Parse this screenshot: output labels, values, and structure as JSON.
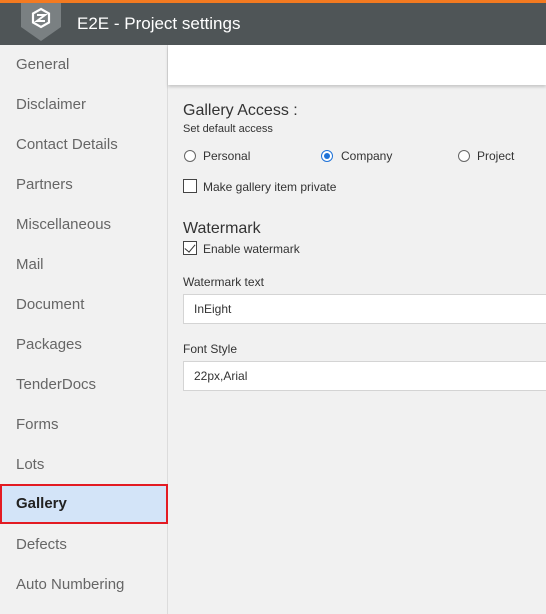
{
  "app": {
    "title": "E2E - Project settings",
    "accent_color": "#f47a20",
    "header_color": "#4f5557",
    "logo_icon": "shield-logo-icon"
  },
  "sidebar": {
    "items": [
      {
        "label": "General"
      },
      {
        "label": "Disclaimer"
      },
      {
        "label": "Contact Details"
      },
      {
        "label": "Partners"
      },
      {
        "label": "Miscellaneous"
      },
      {
        "label": "Mail"
      },
      {
        "label": "Document"
      },
      {
        "label": "Packages"
      },
      {
        "label": "TenderDocs"
      },
      {
        "label": "Forms"
      },
      {
        "label": "Lots"
      },
      {
        "label": "Gallery",
        "active": true
      },
      {
        "label": "Defects"
      },
      {
        "label": "Auto Numbering"
      }
    ],
    "active_highlight_color": "#d3e4f8",
    "active_border_color": "#e31b23"
  },
  "gallery_access": {
    "title": "Gallery Access :",
    "subtitle": "Set default access",
    "options": [
      {
        "label": "Personal",
        "checked": false
      },
      {
        "label": "Company",
        "checked": true
      },
      {
        "label": "Project",
        "checked": false
      }
    ],
    "private_checkbox": {
      "label": "Make gallery item private",
      "checked": false
    }
  },
  "watermark": {
    "title": "Watermark",
    "enable_checkbox": {
      "label": "Enable watermark",
      "checked": true
    },
    "text_label": "Watermark text",
    "text_value": "InEight",
    "font_label": "Font Style",
    "font_value": "22px,Arial"
  }
}
